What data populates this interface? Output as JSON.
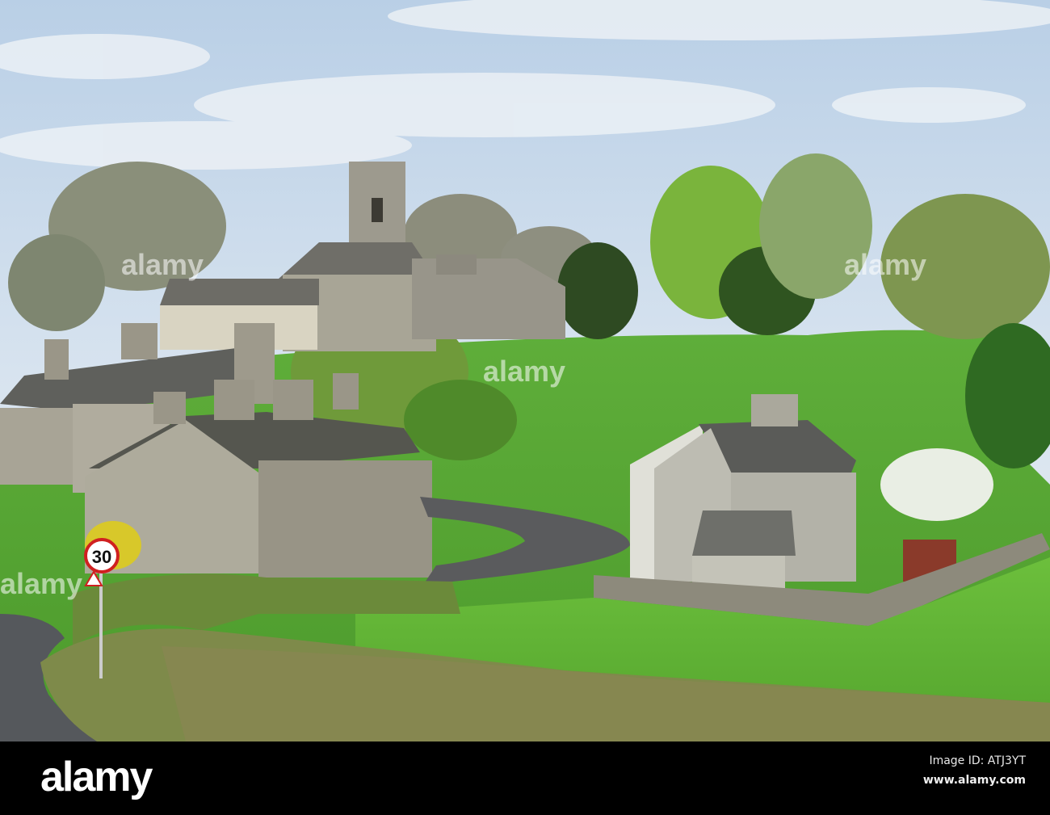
{
  "photo": {
    "sign_speed_limit": "30",
    "watermark": "alamy"
  },
  "footer": {
    "logo": "alamy",
    "image_id": "Image ID: ATJ3YT",
    "website": "www.alamy.com"
  }
}
